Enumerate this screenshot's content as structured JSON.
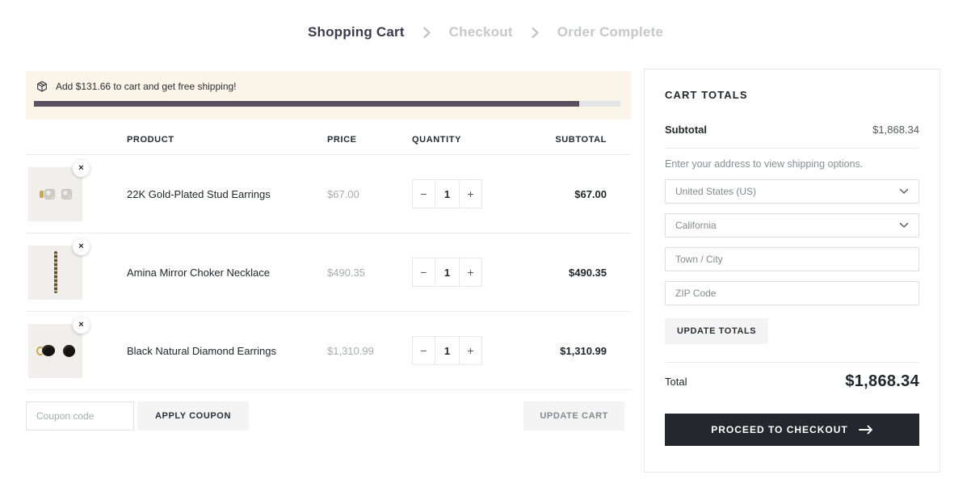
{
  "breadcrumb": {
    "items": [
      {
        "label": "Shopping Cart",
        "active": true
      },
      {
        "label": "Checkout",
        "active": false
      },
      {
        "label": "Order Complete",
        "active": false
      }
    ]
  },
  "shipping_banner": {
    "icon": "package-icon",
    "text": "Add $131.66 to cart and get free shipping!",
    "progress_percent": 93,
    "background_color": "#faf5e8",
    "fill_color": "#57525e",
    "track_color": "#e4e3e5"
  },
  "cart_table": {
    "headers": {
      "product": "PRODUCT",
      "price": "PRICE",
      "quantity": "QUANTITY",
      "subtotal": "SUBTOTAL"
    },
    "remove_glyph": "×",
    "quantity_controls": {
      "minus": "−",
      "plus": "+"
    },
    "rows": [
      {
        "name": "22K Gold-Plated Stud Earrings",
        "price": "$67.00",
        "quantity": "1",
        "subtotal": "$67.00"
      },
      {
        "name": "Amina Mirror Choker Necklace",
        "price": "$490.35",
        "quantity": "1",
        "subtotal": "$490.35"
      },
      {
        "name": "Black Natural Diamond Earrings",
        "price": "$1,310.99",
        "quantity": "1",
        "subtotal": "$1,310.99"
      }
    ]
  },
  "coupon": {
    "placeholder": "Coupon code",
    "apply_label": "APPLY COUPON"
  },
  "update_cart_label": "UPDATE CART",
  "cart_totals": {
    "title": "CART TOTALS",
    "subtotal_label": "Subtotal",
    "subtotal_value": "$1,868.34",
    "address_note": "Enter your address to view shipping options.",
    "country_value": "United States (US)",
    "state_value": "California",
    "city_placeholder": "Town / City",
    "zip_placeholder": "ZIP Code",
    "update_totals_label": "UPDATE TOTALS",
    "total_label": "Total",
    "total_value": "$1,868.34",
    "checkout_label": "PROCEED TO CHECKOUT"
  },
  "colors": {
    "breadcrumb_active": "#3d3a50",
    "breadcrumb_inactive": "#c7c8ca",
    "dark_button": "#24272e",
    "light_button": "#f4f4f4",
    "text_dark": "#23262c",
    "text_muted": "#a8abb0",
    "border": "#ececec",
    "thumb_background": "#f1efec"
  }
}
